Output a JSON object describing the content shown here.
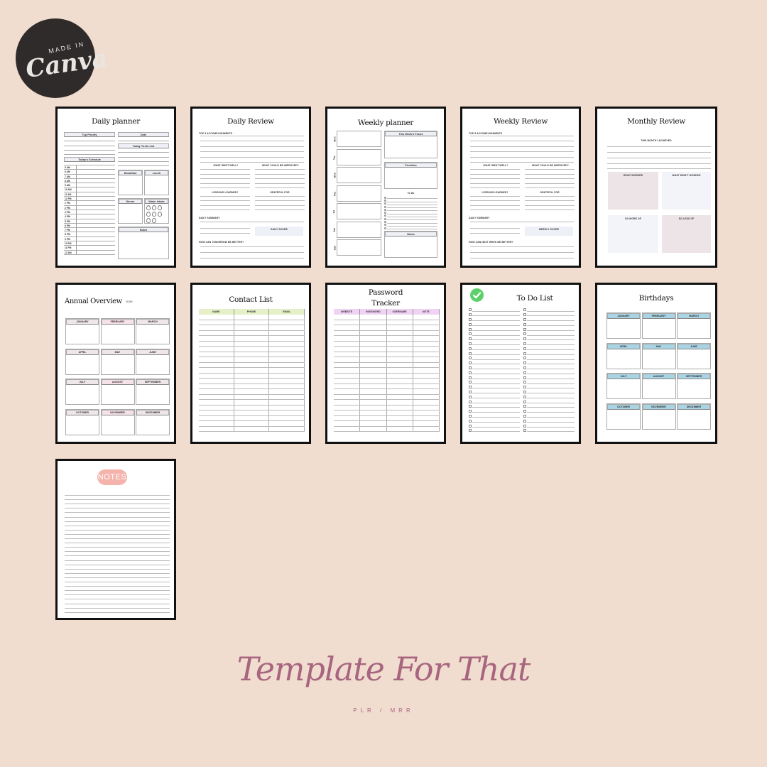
{
  "badge": {
    "top": "MADE IN",
    "word": "Canva"
  },
  "pages": {
    "daily_planner": {
      "title": "Daily planner",
      "top_priority": "Top Priority",
      "date": "Date",
      "todo": "Today To-Do List",
      "schedule": "Today's Schedule",
      "hours": [
        "5 AM",
        "6 AM",
        "7 AM",
        "8 AM",
        "9 AM",
        "10 AM",
        "11 AM",
        "12 PM",
        "1 PM",
        "2 PM",
        "3 PM",
        "4 PM",
        "5 PM",
        "6 PM",
        "7 PM",
        "8 PM",
        "9 PM",
        "10 PM",
        "11 PM",
        "12 AM"
      ],
      "breakfast": "Breakfast",
      "lunch": "Lunch",
      "dinner": "Dinner",
      "water": "Water Intake",
      "water_glasses": 8,
      "notes": "Notes"
    },
    "daily_review": {
      "title": "Daily Review",
      "accomplishments": "TOP 5 ACCOMPLISHMENTS",
      "went_well": "WHAT WENT WELL?",
      "improve": "WHAT COULD BE IMPROVED?",
      "lessons": "LESSONS LEARNED?",
      "grateful": "GRATEFUL FOR",
      "summary": "DAILY SUMMARY",
      "score": "DAILY SCORE",
      "better": "HOW CAN TOMORROW BE BETTER?"
    },
    "weekly_planner": {
      "title": "Weekly planner",
      "days": [
        "Mon",
        "Tue",
        "Wed",
        "Thu",
        "Fri",
        "Sat",
        "Sun"
      ],
      "focus": "This Week's Focus",
      "priorities": "Priorities",
      "todo": "To Do",
      "notes": "Notes"
    },
    "weekly_review": {
      "title": "Weekly Review",
      "accomplishments": "TOP 5 ACCOMPLISHMENTS",
      "went_well": "WHAT WENT WELL?",
      "improve": "WHAT COULD BE IMPROVED?",
      "lessons": "LESSONS LEARNED?",
      "grateful": "GRATEFUL FOR",
      "summary": "DAILY SUMMARY",
      "score": "WEEKLY SCORE",
      "better": "HOW CAN NEXT WEEK BE BETTER?"
    },
    "monthly_review": {
      "title": "Monthly Review",
      "achieved": "THIS MONTH I ACHIEVED",
      "worked": "WHAT WORKED",
      "didnt": "WHAT DIDN'T WORKED",
      "more": "DO MORE OF",
      "less": "DO LESS OF"
    },
    "annual_overview": {
      "title": "Annual Overview",
      "year_label": "YEAR",
      "months": [
        "JANUARY",
        "FEBRUARY",
        "MARCH",
        "APRIL",
        "MAY",
        "JUNE",
        "JULY",
        "AUGUST",
        "SEPTEMBER",
        "OCTOBER",
        "NOVEMBER",
        "DECEMBER"
      ]
    },
    "contact_list": {
      "title": "Contact List",
      "columns": [
        "NAME",
        "PHONE",
        "EMAIL"
      ],
      "header_color": "#e6f0c8"
    },
    "password_tracker": {
      "title_line1": "Password",
      "title_line2": "Tracker",
      "columns": [
        "WEBSITE",
        "PASSWORD",
        "USERNAME",
        "NOTE"
      ],
      "header_color": "#f0d2f4"
    },
    "todo_list": {
      "title": "To Do List",
      "check_color": "#5cd16a"
    },
    "birthdays": {
      "title": "Birthdays",
      "months": [
        "JANUARY",
        "FEBRUARY",
        "MARCH",
        "APRIL",
        "MAY",
        "JUNE",
        "JULY",
        "AUGUST",
        "SEPTEMBER",
        "OCTOBER",
        "NOVEMBER",
        "DECEMBER"
      ],
      "header_color": "#a9d4e4"
    },
    "notes": {
      "title": "NOTES",
      "badge_color": "#f4b3ac"
    }
  },
  "brand": {
    "name": "Template For That",
    "sub": "PLR / MRR"
  }
}
